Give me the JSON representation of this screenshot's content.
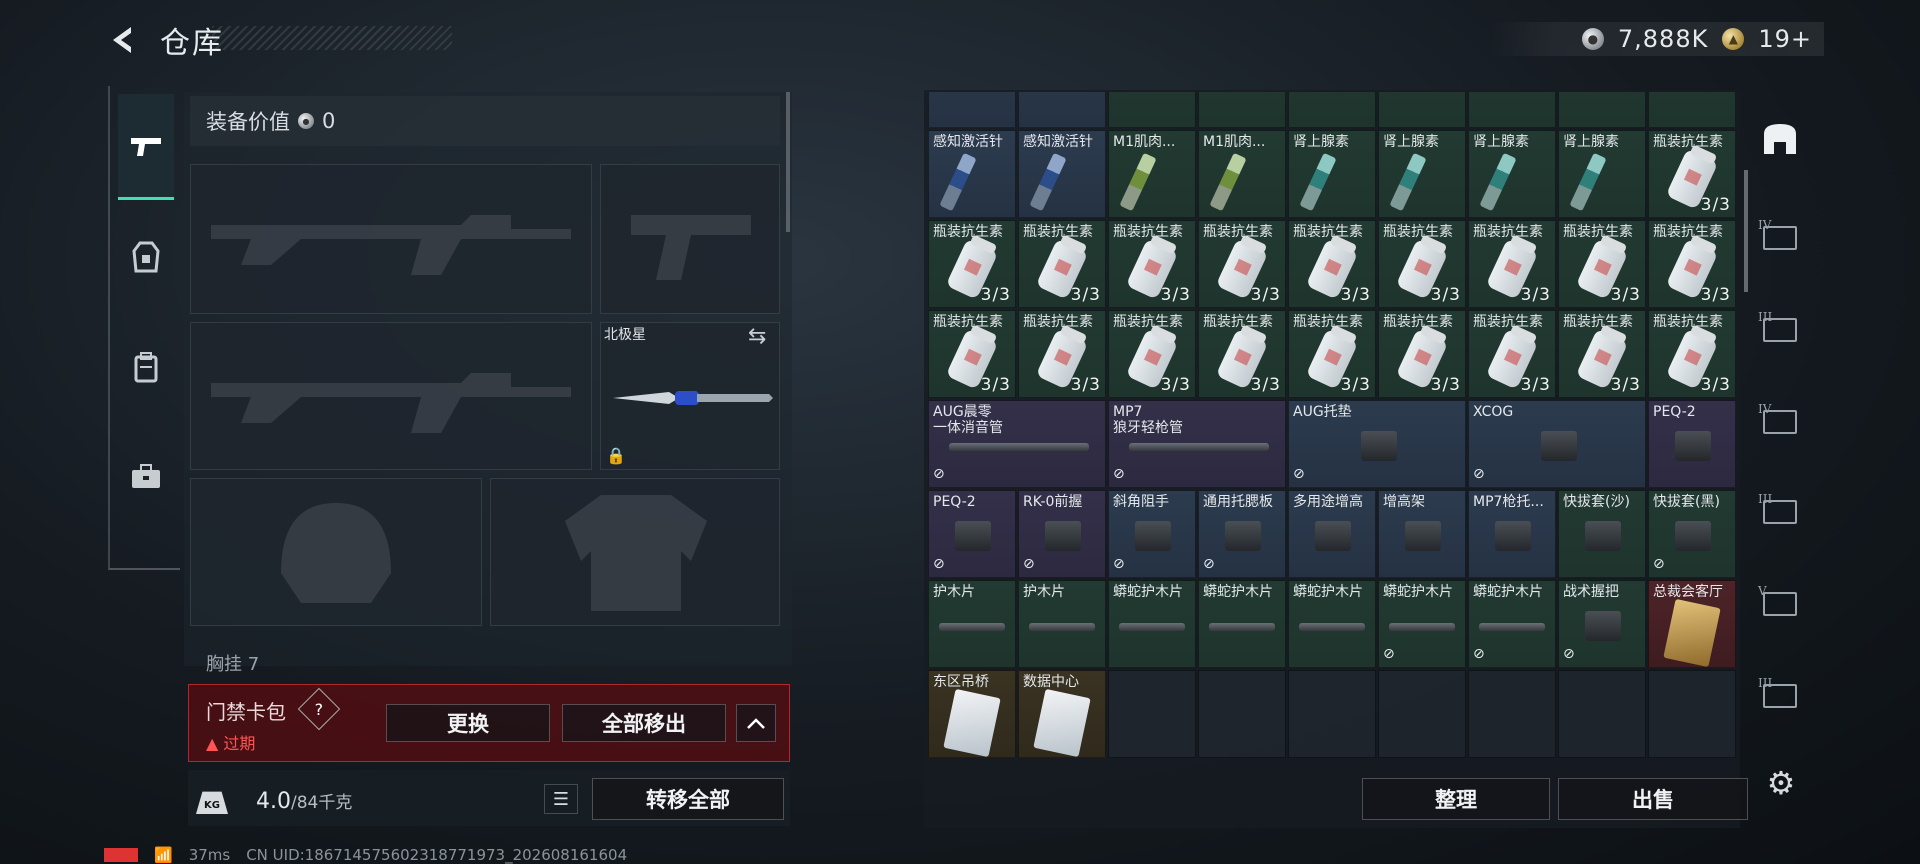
{
  "header": {
    "title": "仓库"
  },
  "currency": {
    "silver": "7,888K",
    "gold": "19+"
  },
  "left_tabs": [
    {
      "name": "weapons"
    },
    {
      "name": "armor"
    },
    {
      "name": "backpack"
    },
    {
      "name": "kit"
    }
  ],
  "loadout": {
    "equip_value_label": "装备价值",
    "equip_value": "0",
    "melee_name": "北极星",
    "chest_label": "胸挂",
    "chest_count": "7"
  },
  "access_card": {
    "name": "门禁卡包",
    "help": "?",
    "status": "过期",
    "replace_label": "更换",
    "remove_all_label": "全部移出",
    "expand_label": "^"
  },
  "weight": {
    "current": "4.0",
    "max": "/84千克",
    "transfer_all_label": "转移全部",
    "kg_label": "KG"
  },
  "status_bar": {
    "ping": "37ms",
    "uid": "CN UID:18671457560231877​1973_202608161604"
  },
  "inventory": {
    "rows": [
      [
        {
          "name": "感知激活针",
          "count": "",
          "type": "inj-blue",
          "rarity": "blue"
        },
        {
          "name": "感知激活针",
          "count": "",
          "type": "inj-blue",
          "rarity": "blue"
        },
        {
          "name": "M1肌肉...",
          "count": "",
          "type": "inj-yg",
          "rarity": "green"
        },
        {
          "name": "M1肌肉...",
          "count": "",
          "type": "inj-yg",
          "rarity": "green"
        },
        {
          "name": "肾上腺素",
          "count": "",
          "type": "inj-teal",
          "rarity": "green"
        },
        {
          "name": "肾上腺素",
          "count": "",
          "type": "inj-teal",
          "rarity": "green"
        },
        {
          "name": "肾上腺素",
          "count": "",
          "type": "inj-teal",
          "rarity": "green"
        },
        {
          "name": "肾上腺素",
          "count": "",
          "type": "inj-teal",
          "rarity": "green"
        },
        {
          "name": "瓶装抗生素",
          "count": "3/3",
          "type": "bottle",
          "rarity": "green"
        }
      ],
      [
        {
          "name": "瓶装抗生素",
          "count": "3/3",
          "type": "bottle",
          "rarity": "green"
        },
        {
          "name": "瓶装抗生素",
          "count": "3/3",
          "type": "bottle",
          "rarity": "green"
        },
        {
          "name": "瓶装抗生素",
          "count": "3/3",
          "type": "bottle",
          "rarity": "green"
        },
        {
          "name": "瓶装抗生素",
          "count": "3/3",
          "type": "bottle",
          "rarity": "green"
        },
        {
          "name": "瓶装抗生素",
          "count": "3/3",
          "type": "bottle",
          "rarity": "green"
        },
        {
          "name": "瓶装抗生素",
          "count": "3/3",
          "type": "bottle",
          "rarity": "green"
        },
        {
          "name": "瓶装抗生素",
          "count": "3/3",
          "type": "bottle",
          "rarity": "green"
        },
        {
          "name": "瓶装抗生素",
          "count": "3/3",
          "type": "bottle",
          "rarity": "green"
        },
        {
          "name": "瓶装抗生素",
          "count": "3/3",
          "type": "bottle",
          "rarity": "green"
        }
      ],
      [
        {
          "name": "瓶装抗生素",
          "count": "3/3",
          "type": "bottle",
          "rarity": "green"
        },
        {
          "name": "瓶装抗生素",
          "count": "3/3",
          "type": "bottle",
          "rarity": "green"
        },
        {
          "name": "瓶装抗生素",
          "count": "3/3",
          "type": "bottle",
          "rarity": "green"
        },
        {
          "name": "瓶装抗生素",
          "count": "3/3",
          "type": "bottle",
          "rarity": "green"
        },
        {
          "name": "瓶装抗生素",
          "count": "3/3",
          "type": "bottle",
          "rarity": "green"
        },
        {
          "name": "瓶装抗生素",
          "count": "3/3",
          "type": "bottle",
          "rarity": "green"
        },
        {
          "name": "瓶装抗生素",
          "count": "3/3",
          "type": "bottle",
          "rarity": "green"
        },
        {
          "name": "瓶装抗生素",
          "count": "3/3",
          "type": "bottle",
          "rarity": "green"
        },
        {
          "name": "瓶装抗生素",
          "count": "3/3",
          "type": "bottle",
          "rarity": "green"
        }
      ]
    ],
    "attach_rows": [
      [
        {
          "name": "AUG晨零\n一体消音管",
          "span": 2,
          "type": "rail",
          "rarity": "purple",
          "nb": true
        },
        {
          "name": "MP7\n狼牙轻枪管",
          "span": 2,
          "type": "rail",
          "rarity": "purple",
          "nb": true
        },
        {
          "name": "AUG托垫",
          "span": 2,
          "type": "att",
          "rarity": "blue",
          "nb": true
        },
        {
          "name": "XCOG",
          "span": 2,
          "type": "att",
          "rarity": "blue",
          "nb": true
        },
        {
          "name": "PEQ-2",
          "span": 1,
          "type": "att",
          "rarity": "purple",
          "nb": false
        }
      ],
      [
        {
          "name": "PEQ-2",
          "span": 1,
          "type": "att",
          "rarity": "purple",
          "nb": true
        },
        {
          "name": "RK-0前握",
          "span": 1,
          "type": "att",
          "rarity": "purple",
          "nb": true
        },
        {
          "name": "斜角阻手",
          "span": 1,
          "type": "att",
          "rarity": "blue",
          "nb": true
        },
        {
          "name": "通用托腮板",
          "span": 1,
          "type": "att",
          "rarity": "blue",
          "nb": true
        },
        {
          "name": "多用途增高",
          "span": 1,
          "type": "att",
          "rarity": "blue",
          "nb": false
        },
        {
          "name": "增高架",
          "span": 1,
          "type": "att",
          "rarity": "blue",
          "nb": false
        },
        {
          "name": "MP7枪托...",
          "span": 1,
          "type": "att",
          "rarity": "blue",
          "nb": false
        },
        {
          "name": "快拔套(沙)",
          "span": 1,
          "type": "att",
          "rarity": "green",
          "nb": false
        },
        {
          "name": "快拔套(黑)",
          "span": 1,
          "type": "att",
          "rarity": "green",
          "nb": true
        }
      ],
      [
        {
          "name": "护木片",
          "span": 1,
          "type": "rail",
          "rarity": "green",
          "nb": false
        },
        {
          "name": "护木片",
          "span": 1,
          "type": "rail",
          "rarity": "green",
          "nb": false
        },
        {
          "name": "蟒蛇护木片",
          "span": 1,
          "type": "rail",
          "rarity": "green",
          "nb": false
        },
        {
          "name": "蟒蛇护木片",
          "span": 1,
          "type": "rail",
          "rarity": "green",
          "nb": false
        },
        {
          "name": "蟒蛇护木片",
          "span": 1,
          "type": "rail",
          "rarity": "green",
          "nb": false
        },
        {
          "name": "蟒蛇护木片",
          "span": 1,
          "type": "rail",
          "rarity": "green",
          "nb": true
        },
        {
          "name": "蟒蛇护木片",
          "span": 1,
          "type": "rail",
          "rarity": "green",
          "nb": true
        },
        {
          "name": "战术握把",
          "span": 1,
          "type": "att",
          "rarity": "green",
          "nb": true
        },
        {
          "name": "总裁会客厅",
          "span": 1,
          "type": "card-gold",
          "rarity": "red",
          "nb": false
        }
      ],
      [
        {
          "name": "东区吊桥",
          "span": 1,
          "type": "card",
          "rarity": "gold",
          "nb": false
        },
        {
          "name": "数据中心",
          "span": 1,
          "type": "card",
          "rarity": "gold",
          "nb": false
        }
      ]
    ]
  },
  "right_rail": [
    {
      "name": "safe-box",
      "level": ""
    },
    {
      "name": "storage-box-iv",
      "level": "IV"
    },
    {
      "name": "storage-box-iii",
      "level": "III"
    },
    {
      "name": "storage-box-iv-2",
      "level": "IV"
    },
    {
      "name": "storage-box-iii-2",
      "level": "III"
    },
    {
      "name": "storage-box-v",
      "level": "V"
    },
    {
      "name": "storage-box-iii-3",
      "level": "III"
    }
  ],
  "actions": {
    "sort_label": "整理",
    "sell_label": "出售"
  },
  "colors": {
    "accent": "#3fe0b4",
    "danger": "#ff5454",
    "card_bg": "#500e12"
  }
}
